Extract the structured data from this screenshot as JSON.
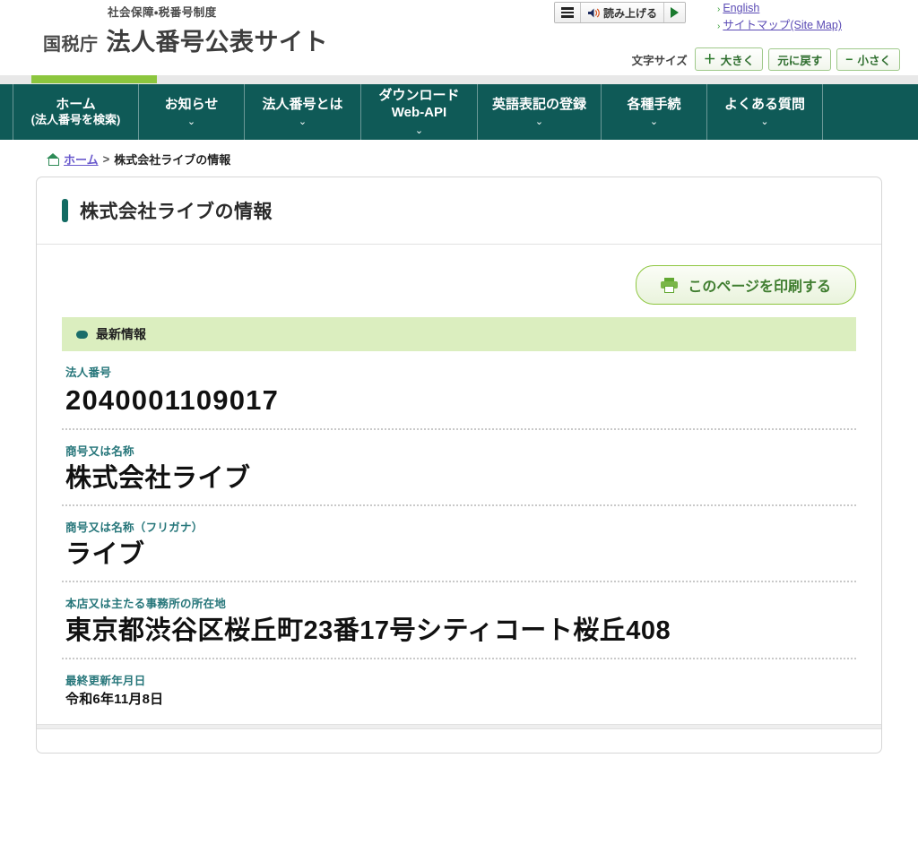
{
  "header": {
    "brand_sub": "社会保障・税番号制度",
    "brand_agency": "国税庁",
    "brand_title": "法人番号公表サイト",
    "readaloud": {
      "menu_icon": "hamburger-icon",
      "speaker_icon": "speaker-icon",
      "label": "読み上げる",
      "play_icon": "play-icon"
    },
    "toplinks": [
      {
        "label": "English"
      },
      {
        "label": "サイトマップ(Site Map)"
      }
    ],
    "fontsize": {
      "label": "文字サイズ",
      "larger_sign": "＋",
      "larger": "大きく",
      "reset": "元に戻す",
      "smaller_sign": "−",
      "smaller": "小さく"
    }
  },
  "nav": {
    "items": [
      {
        "line1": "ホーム",
        "line2": "(法人番号を検索)",
        "caret": ""
      },
      {
        "line1": "お知らせ",
        "line2": "",
        "caret": "⌄"
      },
      {
        "line1": "法人番号とは",
        "line2": "",
        "caret": "⌄"
      },
      {
        "line1": "ダウンロード",
        "line2": "Web-API",
        "caret": "⌄"
      },
      {
        "line1": "英語表記の登録",
        "line2": "",
        "caret": "⌄"
      },
      {
        "line1": "各種手続",
        "line2": "",
        "caret": "⌄"
      },
      {
        "line1": "よくある質問",
        "line2": "",
        "caret": "⌄"
      }
    ]
  },
  "breadcrumb": {
    "home_icon": "home-icon",
    "home": "ホーム",
    "separator": ">",
    "current": "株式会社ライブの情報"
  },
  "page": {
    "title": "株式会社ライブの情報",
    "print_button": "このページを印刷する",
    "print_icon": "printer-icon",
    "section_title": "最新情報",
    "fields": [
      {
        "label": "法人番号",
        "value": "2040001109017",
        "style": "num"
      },
      {
        "label": "商号又は名称",
        "value": "株式会社ライブ",
        "style": "big"
      },
      {
        "label": "商号又は名称（フリガナ）",
        "value": "ライブ",
        "style": "big"
      },
      {
        "label": "本店又は主たる事務所の所在地",
        "value": "東京都渋谷区桜丘町23番17号シティコート桜丘408",
        "style": "big"
      },
      {
        "label": "最終更新年月日",
        "value": "令和6年11月8日",
        "style": "small"
      }
    ]
  },
  "colors": {
    "nav_bg": "#0f5a57",
    "accent_green": "#8cc63e",
    "section_bg": "#dbeebf",
    "label_teal": "#26767a",
    "link_purple": "#6a5acd"
  }
}
